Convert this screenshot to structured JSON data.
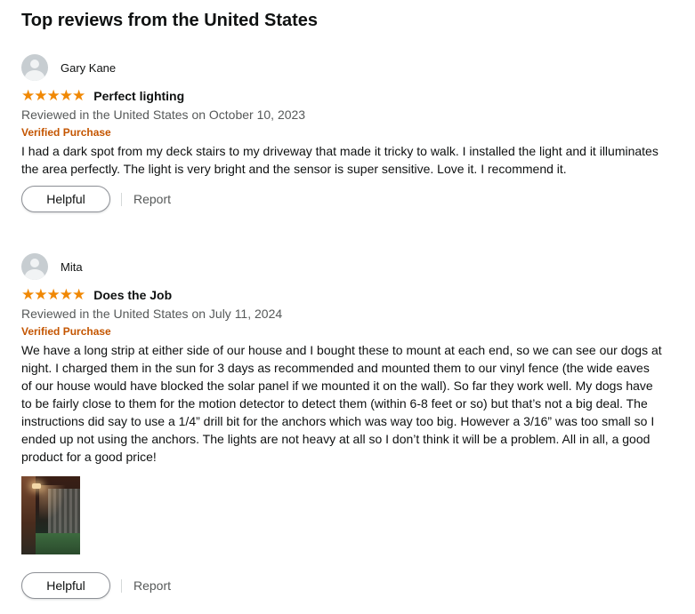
{
  "section_heading": "Top reviews from the United States",
  "reviews": [
    {
      "reviewer_name": "Gary Kane",
      "stars": [
        "★",
        "★",
        "★",
        "★",
        "★"
      ],
      "title": "Perfect lighting",
      "date_text": "Reviewed in the United States on October 10, 2023",
      "verified_label": "Verified Purchase",
      "body": "I had a dark spot from my deck stairs to my driveway that made it tricky to walk. I installed the light and it illuminates the area perfectly. The light is very bright and the sensor is super sensitive. Love it. I recommend it.",
      "helpful_label": "Helpful",
      "report_label": "Report"
    },
    {
      "reviewer_name": "Mita",
      "stars": [
        "★",
        "★",
        "★",
        "★",
        "★"
      ],
      "title": "Does the Job",
      "date_text": "Reviewed in the United States on July 11, 2024",
      "verified_label": "Verified Purchase",
      "body": "We have a long strip at either side of our house and I bought these to mount at each end, so we can see our dogs at night. I charged them in the sun for 3 days as recommended and mounted them to our vinyl fence (the wide eaves of our house would have blocked the solar panel if we mounted it on the wall). So far they work well. My dogs have to be fairly close to them for the motion detector to detect them (within 6-8 feet or so) but that’s not a big deal. The instructions did say to use a 1/4” drill bit for the anchors which was way too big. However a 3/16” was too small so I ended up not using the anchors. The lights are not heavy at all so I don’t think it will be a problem. All in all, a good product for a good price!",
      "helpful_label": "Helpful",
      "report_label": "Report"
    }
  ],
  "colors": {
    "star": "#f08804",
    "verified": "#c45500",
    "secondary_text": "#565959"
  },
  "icons": {
    "avatar": "default-profile-icon",
    "star": "star-icon"
  }
}
